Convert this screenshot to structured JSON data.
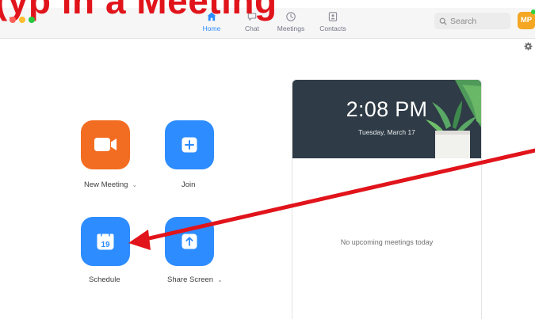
{
  "headline": "(yp in a Meeting",
  "window": {
    "traffic_colors": [
      "#ff5f57",
      "#febc2e",
      "#28c840"
    ]
  },
  "nav": {
    "items": [
      {
        "label": "Home",
        "icon": "home-icon",
        "active": true
      },
      {
        "label": "Chat",
        "icon": "chat-icon",
        "active": false
      },
      {
        "label": "Meetings",
        "icon": "clock-icon",
        "active": false
      },
      {
        "label": "Contacts",
        "icon": "contacts-icon",
        "active": false
      }
    ],
    "accent": "#2d8cff"
  },
  "search": {
    "placeholder": "Search"
  },
  "avatar": {
    "initials": "MP",
    "color": "#f5a623",
    "status_color": "#2ad13f"
  },
  "actions": {
    "new_meeting": {
      "label": "New Meeting",
      "color": "#f26d21",
      "icon": "video-camera-icon"
    },
    "join": {
      "label": "Join",
      "color": "#2d8cff",
      "icon": "plus-icon"
    },
    "schedule": {
      "label": "Schedule",
      "color": "#2d8cff",
      "icon": "calendar-icon",
      "day": "19"
    },
    "share_screen": {
      "label": "Share Screen",
      "color": "#2d8cff",
      "icon": "arrow-up-icon"
    }
  },
  "panel": {
    "time": "2:08 PM",
    "date": "Tuesday, March 17",
    "empty_message": "No upcoming meetings today"
  },
  "annotation": {
    "color": "#e1141b",
    "icon": "red-arrow-pointer"
  }
}
